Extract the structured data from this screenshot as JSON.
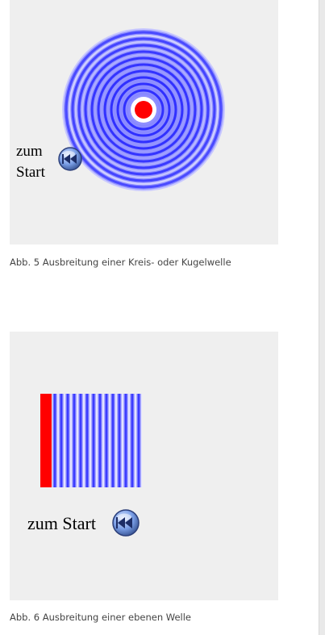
{
  "figures": [
    {
      "id": "abb5",
      "caption": "Abb. 5 Ausbreitung einer Kreis- oder Kugelwelle",
      "start_label_line1": "zum",
      "start_label_line2": "Start",
      "button_icon": "rewind-icon"
    },
    {
      "id": "abb6",
      "caption": "Abb. 6 Ausbreitung einer ebenen Welle",
      "start_label": "zum Start",
      "button_icon": "rewind-icon"
    }
  ],
  "colors": {
    "panel_bg": "#efefef",
    "wave_blue": "#3030ff",
    "wave_light": "#d8d8ff",
    "source_red": "#ff0000",
    "label_blue": "#1b1bd6"
  }
}
